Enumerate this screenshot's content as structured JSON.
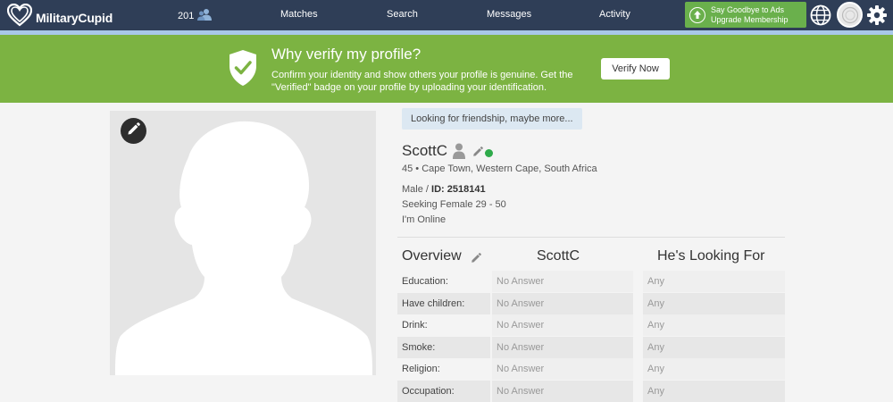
{
  "nav": {
    "logo_text": "MilitaryCupid",
    "count": "201",
    "links": [
      "Matches",
      "Search",
      "Messages",
      "Activity"
    ],
    "upgrade_line1": "Say Goodbye to Ads",
    "upgrade_line2": "Upgrade Membership"
  },
  "verify": {
    "title": "Why verify my profile?",
    "body": "Confirm your identity and show others your profile is genuine. Get the \"Verified\" badge on your profile by uploading your identification.",
    "button": "Verify Now"
  },
  "profile": {
    "tagline": "Looking for friendship, maybe more...",
    "username": "ScottC",
    "location": "45 • Cape Town, Western Cape, South Africa",
    "gender": "Male / ",
    "id_label": "ID: 2518141",
    "seeking": "Seeking Female 29 - 50",
    "status": "I'm Online"
  },
  "overview": {
    "title": "Overview",
    "col_user": "ScottC",
    "col_looking": "He's Looking For",
    "rows": [
      {
        "label": "Education:",
        "value": "No Answer",
        "looking": "Any"
      },
      {
        "label": "Have children:",
        "value": "No Answer",
        "looking": "Any"
      },
      {
        "label": "Drink:",
        "value": "No Answer",
        "looking": "Any"
      },
      {
        "label": "Smoke:",
        "value": "No Answer",
        "looking": "Any"
      },
      {
        "label": "Religion:",
        "value": "No Answer",
        "looking": "Any"
      },
      {
        "label": "Occupation:",
        "value": "No Answer",
        "looking": "Any"
      }
    ]
  },
  "icons": {
    "logo": "heart-logo-icon",
    "users": "users-icon",
    "upgrade": "arrow-up-circle-icon",
    "globe": "globe-icon",
    "settings": "gear-icon",
    "verify": "shield-check-icon",
    "edit": "pencil-icon",
    "profile": "person-icon"
  },
  "colors": {
    "nav": "#2f3e57",
    "banner": "#7cb342",
    "upgrade": "#6ab04c",
    "online": "#2eaa4a"
  }
}
